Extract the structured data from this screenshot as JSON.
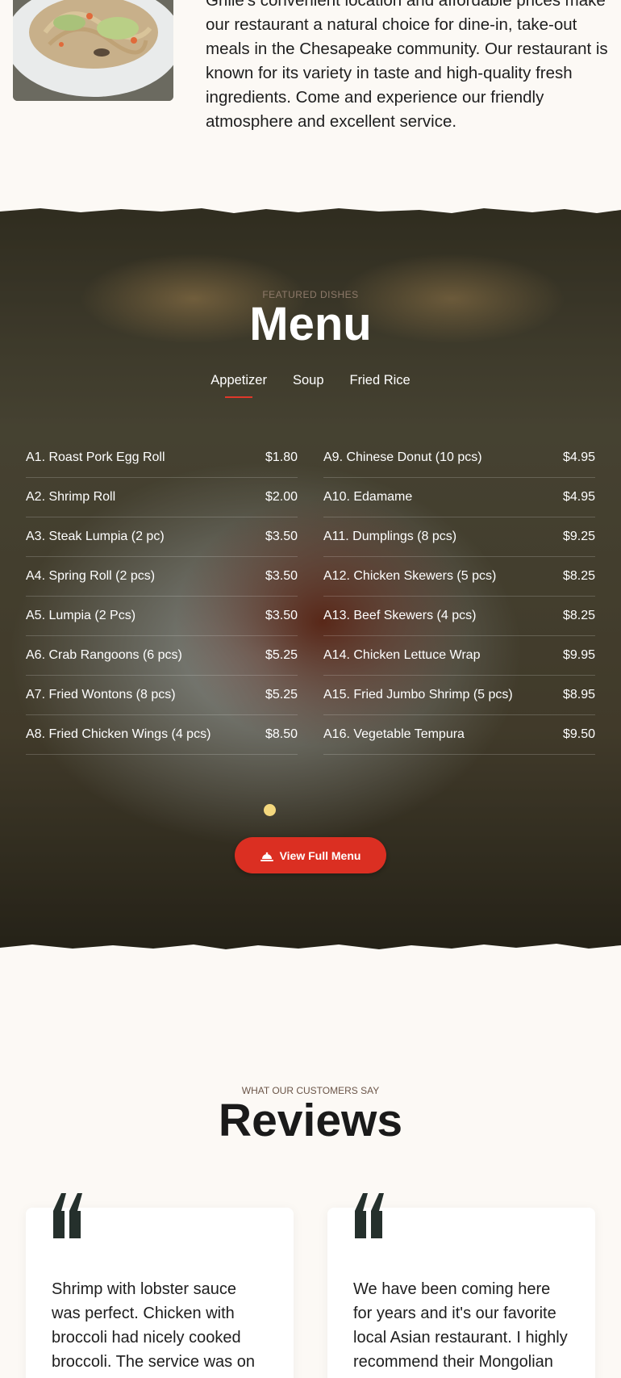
{
  "about": {
    "image_alt": "noodle-dish",
    "text": "Grille's convenient location and affordable prices make our restaurant a natural choice for dine-in, take-out meals in the Chesapeake community. Our restaurant is known for its variety in taste and high-quality fresh ingredients. Come and experience our friendly atmosphere and excellent service."
  },
  "menu": {
    "eyebrow": "FEATURED DISHES",
    "title": "Menu",
    "tabs": [
      {
        "label": "Appetizer",
        "active": true
      },
      {
        "label": "Soup",
        "active": false
      },
      {
        "label": "Fried Rice",
        "active": false
      }
    ],
    "left_items": [
      {
        "name": "A1. Roast Pork Egg Roll",
        "price": "$1.80"
      },
      {
        "name": "A2. Shrimp Roll",
        "price": "$2.00"
      },
      {
        "name": "A3. Steak Lumpia (2 pc)",
        "price": "$3.50"
      },
      {
        "name": "A4. Spring Roll (2 pcs)",
        "price": "$3.50"
      },
      {
        "name": "A5. Lumpia (2 Pcs)",
        "price": "$3.50"
      },
      {
        "name": "A6. Crab Rangoons (6 pcs)",
        "price": "$5.25"
      },
      {
        "name": "A7. Fried Wontons (8 pcs)",
        "price": "$5.25"
      },
      {
        "name": "A8. Fried Chicken Wings (4 pcs)",
        "price": "$8.50"
      }
    ],
    "right_items": [
      {
        "name": "A9. Chinese Donut (10 pcs)",
        "price": "$4.95"
      },
      {
        "name": "A10. Edamame",
        "price": "$4.95"
      },
      {
        "name": "A11. Dumplings (8 pcs)",
        "price": "$9.25"
      },
      {
        "name": "A12. Chicken Skewers (5 pcs)",
        "price": "$8.25"
      },
      {
        "name": "A13. Beef Skewers (4 pcs)",
        "price": "$8.25"
      },
      {
        "name": "A14. Chicken Lettuce Wrap",
        "price": "$9.95"
      },
      {
        "name": "A15. Fried Jumbo Shrimp (5 pcs)",
        "price": "$8.95"
      },
      {
        "name": "A16. Vegetable Tempura",
        "price": "$9.50"
      }
    ],
    "button_label": "View Full Menu",
    "button_icon": "cloche-icon"
  },
  "reviews": {
    "eyebrow": "WHAT OUR CUSTOMERS SAY",
    "title": "Reviews",
    "cards": [
      {
        "text": "Shrimp with lobster sauce was perfect. Chicken with broccoli had nicely cooked broccoli. The service was on"
      },
      {
        "text": "We have been coming here for years and it's our favorite local Asian restaurant. I highly recommend their Mongolian"
      }
    ]
  },
  "colors": {
    "accent_red": "#db2f22",
    "page_bg": "#fcf9f5",
    "dot_yellow": "#f4d87e",
    "quote_dark": "#25302c"
  }
}
